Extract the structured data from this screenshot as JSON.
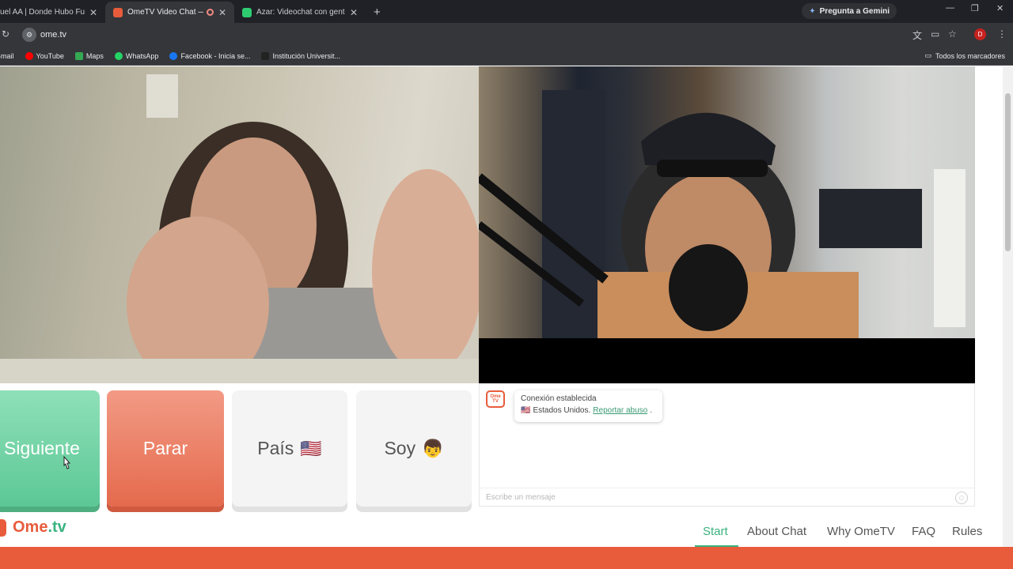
{
  "tabs": [
    {
      "title": "uel AA | Donde Hubo Fuego",
      "favicon_color": "#e53935",
      "active": false
    },
    {
      "title": "OmeTV Video Chat — Ome",
      "favicon_color": "#e85c3c",
      "active": true,
      "recording": true
    },
    {
      "title": "Azar: Videochat con gente nue",
      "favicon_color": "#2ecc71",
      "active": false
    }
  ],
  "gemini_label": "Pregunta a Gemini",
  "address": {
    "url": "ome.tv"
  },
  "bookmarks": [
    {
      "label": "Gmail",
      "color": "#ea4335"
    },
    {
      "label": "YouTube",
      "color": "#ff0000"
    },
    {
      "label": "Maps",
      "color": "#34a853"
    },
    {
      "label": "WhatsApp",
      "color": "#25d366"
    },
    {
      "label": "Facebook - Inicia se...",
      "color": "#1877f2"
    },
    {
      "label": "Institución Universit...",
      "color": "#222222"
    }
  ],
  "all_bookmarks_label": "Todos los marcadores",
  "controls": {
    "next_label": "Siguiente",
    "stop_label": "Parar",
    "country_label": "País",
    "country_flag": "🇺🇸",
    "gender_label": "Soy",
    "gender_emoji": "👦"
  },
  "chat": {
    "logo_text": "Ome TV",
    "status_line": "Conexión establecida",
    "country_flag": "🇺🇸",
    "country_text": "Estados Unidos.",
    "report_link": "Reportar abuso",
    "input_placeholder": "Escribe un mensaje"
  },
  "footer": {
    "brand_main": "Ome",
    "brand_tld": ".tv",
    "nav": [
      "Start",
      "About Chat",
      "Why OmeTV",
      "FAQ",
      "Rules"
    ],
    "active_nav": "Start"
  },
  "colors": {
    "brand_orange": "#e85c3c",
    "brand_green": "#3ab27f",
    "next_green": "#5cc896",
    "stop_red": "#e56a4d"
  }
}
